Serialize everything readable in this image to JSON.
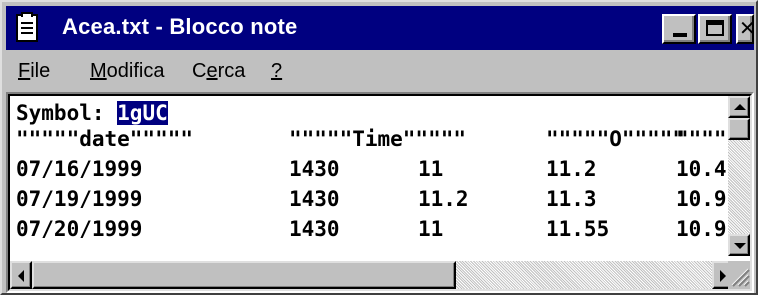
{
  "window": {
    "title": "Acea.txt - Blocco note",
    "icon": "notepad-icon",
    "controls": {
      "minimize": "minimize-icon",
      "maximize": "maximize-icon",
      "close_glyph": "✕"
    }
  },
  "menu": {
    "items": [
      {
        "mnemonic": "F",
        "rest": "ile"
      },
      {
        "mnemonic": "M",
        "rest": "odifica"
      },
      {
        "pre": "C",
        "mnemonic": "e",
        "rest": "rca"
      },
      {
        "mnemonic": "?",
        "rest": ""
      }
    ]
  },
  "document": {
    "symbol_label": "Symbol: ",
    "symbol_value": "1gUC",
    "header": {
      "date": "\"\"\"\"\"date\"\"\"\"\"",
      "time": "\"\"\"\"\"Time\"\"\"\"\"",
      "open": "\"\"\"\"\"O\"\"\"\"\"",
      "high": "\"\"\"\"\"H\"\"\"\"\""
    },
    "rows": [
      {
        "date": "07/16/1999",
        "time": "1430",
        "c3": "11",
        "open": "11.2",
        "high": "10.4"
      },
      {
        "date": "07/19/1999",
        "time": "1430",
        "c3": "11.2",
        "open": "11.3",
        "high": "10.9"
      },
      {
        "date": "07/20/1999",
        "time": "1430",
        "c3": "11",
        "open": "11.55",
        "high": "10.9"
      }
    ]
  },
  "colors": {
    "title_bar": "#000080",
    "selection": "#000080",
    "chrome": "#c0c0c0"
  }
}
